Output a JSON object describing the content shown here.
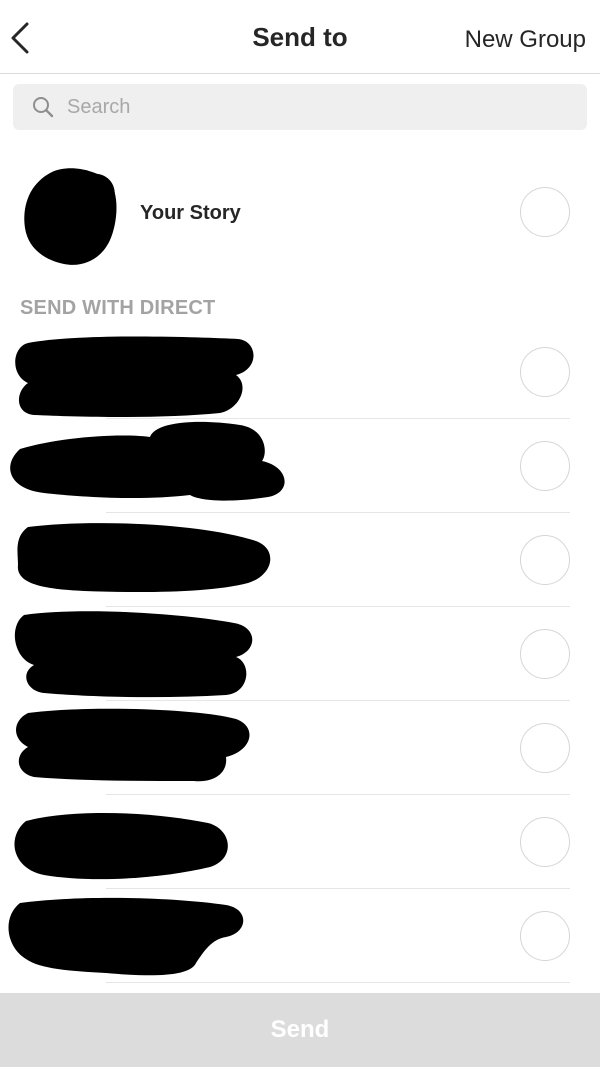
{
  "header": {
    "title": "Send to",
    "new_group_label": "New Group"
  },
  "search": {
    "placeholder": "Search",
    "value": ""
  },
  "story": {
    "label": "Your Story"
  },
  "section": {
    "label": "SEND WITH DIRECT"
  },
  "contacts": [
    {
      "name_redacted": true
    },
    {
      "name_redacted": true
    },
    {
      "name_redacted": true
    },
    {
      "name_redacted": true
    },
    {
      "name_redacted": true
    },
    {
      "name_redacted": true
    },
    {
      "name_redacted": true
    }
  ],
  "footer": {
    "send_label": "Send"
  },
  "colors": {
    "redaction": "#000000",
    "divider": "#e6e6e6",
    "section_label": "#a3a3a3",
    "send_bar_disabled": "#dcdcdc"
  }
}
